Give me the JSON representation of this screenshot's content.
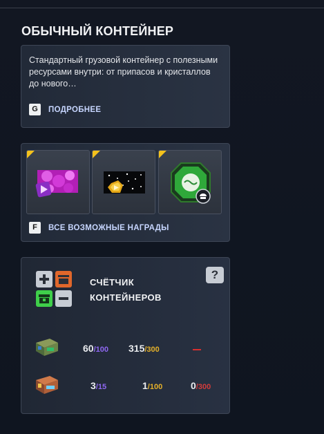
{
  "header": {
    "title": "ОБЫЧНЫЙ КОНТЕЙНЕР"
  },
  "description": {
    "text": "Стандартный грузовой контейнер с полезными ресурсами внутри: от припасов и кристаллов до нового…",
    "key": "G",
    "more_label": "ПОДРОБНЕЕ"
  },
  "rewards": {
    "items": [
      {
        "icon": "paint-icon"
      },
      {
        "icon": "crystal-shot-icon"
      },
      {
        "icon": "drone-module-icon"
      }
    ],
    "key": "F",
    "label": "ВСЕ ВОЗМОЖНЫЕ НАГРАДЫ"
  },
  "counter": {
    "title_line1": "СЧЁТЧИК",
    "title_line2": "КОНТЕЙНЕРОВ",
    "help": "?",
    "rows": [
      {
        "icon": "common-container-icon",
        "a_value": "60",
        "a_max": "/100",
        "b_value": "315",
        "b_max": "/300",
        "c": "dash"
      },
      {
        "icon": "rare-container-icon",
        "a_value": "3",
        "a_max": "/15",
        "b_value": "1",
        "b_max": "/100",
        "c_value": "0",
        "c_max": "/300"
      }
    ]
  },
  "colors": {
    "accent_gold": "#f4c21c",
    "link": "#c7d6ff",
    "purple": "#8f68f2",
    "gold": "#e5b12a",
    "red": "#d23b3b"
  }
}
